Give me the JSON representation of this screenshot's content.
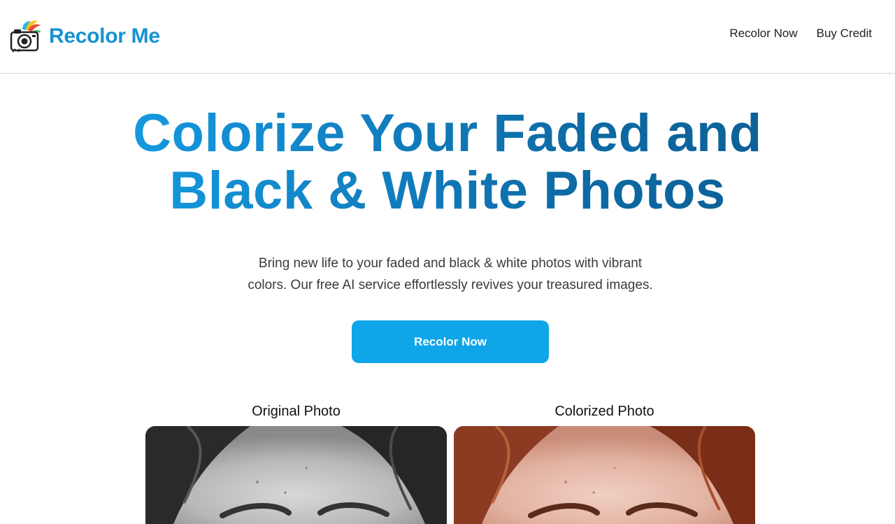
{
  "brand": {
    "name": "Recolor Me",
    "logo_icon": "camera-with-paintbrush-icon"
  },
  "nav": {
    "items": [
      {
        "label": "Recolor Now"
      },
      {
        "label": "Buy Credit"
      }
    ]
  },
  "hero": {
    "title_line1": "Colorize Your Faded and",
    "title_line2": "Black & White Photos",
    "subtitle_line1": "Bring new life to your faded and black & white photos with vibrant",
    "subtitle_line2": "colors. Our free AI service effortlessly revives your treasured images.",
    "cta_label": "Recolor Now"
  },
  "comparison": {
    "original_label": "Original Photo",
    "colorized_label": "Colorized Photo"
  },
  "colors": {
    "brand_blue": "#1592d3",
    "cta_blue": "#0ea5e9",
    "title_gradient_start": "#17a7ee",
    "title_gradient_end": "#0a5a8e"
  }
}
